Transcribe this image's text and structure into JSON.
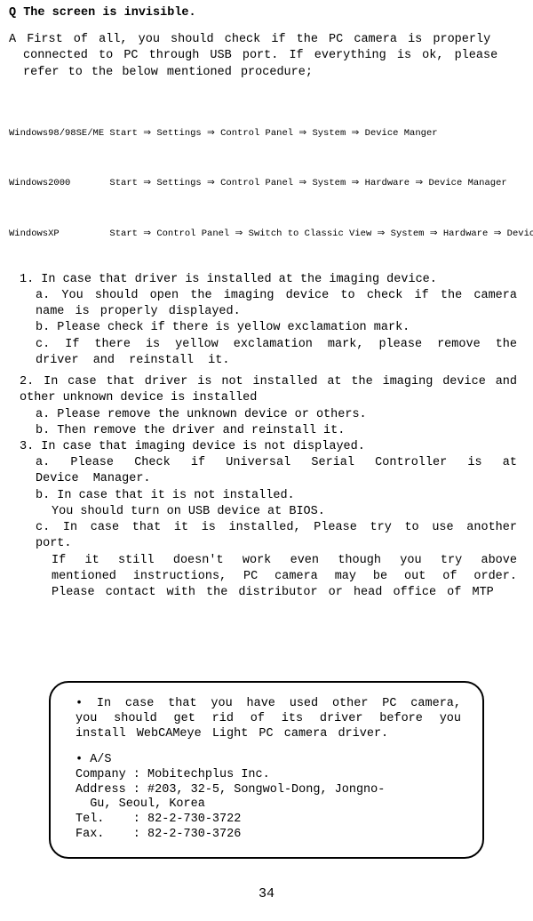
{
  "question": "Q The screen is invisible.",
  "answer_intro_l1": "A First of all, you should check if the PC camera is properly",
  "answer_intro_l2": "connected to PC through USB port. If everything is ok, please",
  "answer_intro_l3": "refer to the below mentioned procedure;",
  "os_rows": [
    "Windows98/98SE/ME Start ⇒ Settings ⇒ Control Panel ⇒ System ⇒ Device Manger",
    "Windows2000       Start ⇒ Settings ⇒ Control Panel ⇒ System ⇒ Hardware ⇒ Device Manager",
    "WindowsXP         Start ⇒ Control Panel ⇒ Switch to Classic View ⇒ System ⇒ Hardware ⇒ Device Manager"
  ],
  "case1_title": "1. In case that driver is installed at the imaging device.",
  "case1_a": "a. You should open the imaging device to check if the camera name is properly displayed.",
  "case1_b": "b. Please check if there is yellow exclamation mark.",
  "case1_c": "c. If there is yellow exclamation mark, please remove the driver and reinstall it.",
  "case2_title": "2. In case that driver is not installed at the imaging device and other unknown device is installed",
  "case2_a": "a. Please remove the unknown device or others.",
  "case2_b": "b. Then remove the driver and reinstall it.",
  "case3_title": "3. In case that imaging device is not displayed.",
  "case3_a": "a. Please Check if Universal Serial Controller is at Device Manager.",
  "case3_b": "b. In case that it is not installed.",
  "case3_b_sub": "You should turn on USB device at BIOS.",
  "case3_c": "c. In case that it is installed, Please try to use another port.",
  "case3_footer": "If it still doesn't work even though you try above mentioned instructions, PC camera may be out of order. Please contact with the distributor or head office of MTP",
  "note_p1": "• In case that you have used other PC camera, you should get rid of its driver before you install WebCAMeye Light PC camera driver.",
  "note_as": "• A/S",
  "note_company": "Company : Mobitechplus Inc.",
  "note_addr1": "Address : #203, 32-5, Songwol-Dong, Jongno-",
  "note_addr2": "  Gu, Seoul, Korea",
  "note_tel": "Tel.    : 82-2-730-3722",
  "note_fax": "Fax.    : 82-2-730-3726",
  "page_no": "34"
}
